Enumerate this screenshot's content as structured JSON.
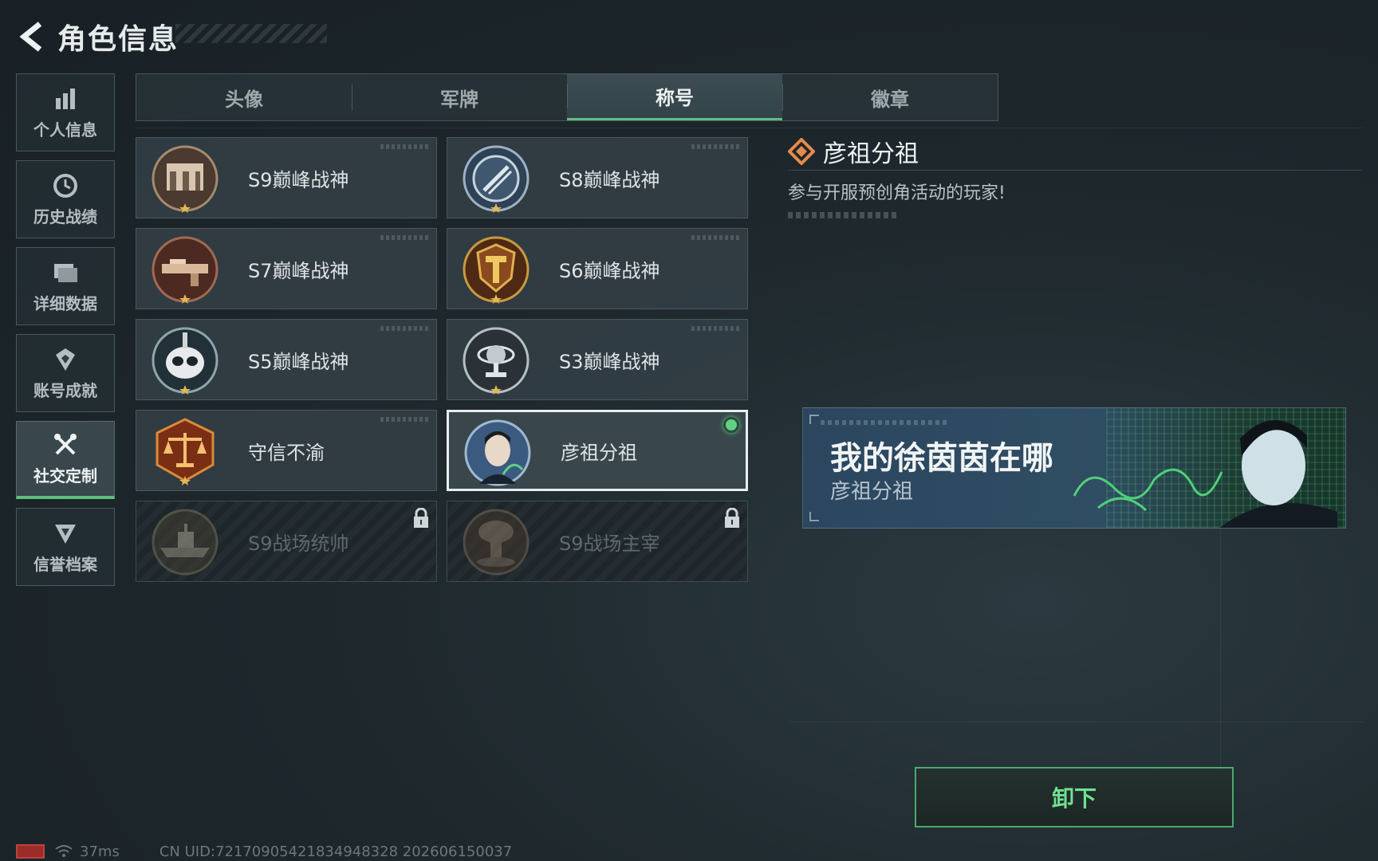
{
  "header": {
    "title": "角色信息"
  },
  "sidebar": {
    "items": [
      {
        "label": "个人信息",
        "icon": "bar-chart-icon",
        "active": false
      },
      {
        "label": "历史战绩",
        "icon": "history-clock-icon",
        "active": false
      },
      {
        "label": "详细数据",
        "icon": "folder-icon",
        "active": false
      },
      {
        "label": "账号成就",
        "icon": "achievement-icon",
        "active": false
      },
      {
        "label": "社交定制",
        "icon": "tools-icon",
        "active": true
      },
      {
        "label": "信誉档案",
        "icon": "credit-shield-icon",
        "active": false
      }
    ]
  },
  "tabs": [
    {
      "label": "头像",
      "active": false
    },
    {
      "label": "军牌",
      "active": false
    },
    {
      "label": "称号",
      "active": true
    },
    {
      "label": "徽章",
      "active": false
    }
  ],
  "titles": [
    {
      "label": "S9巅峰战神",
      "emblem": "s9-emblem-icon",
      "locked": false,
      "selected": false
    },
    {
      "label": "S8巅峰战神",
      "emblem": "s8-emblem-icon",
      "locked": false,
      "selected": false
    },
    {
      "label": "S7巅峰战神",
      "emblem": "s7-emblem-icon",
      "locked": false,
      "selected": false
    },
    {
      "label": "S6巅峰战神",
      "emblem": "s6-emblem-icon",
      "locked": false,
      "selected": false
    },
    {
      "label": "S5巅峰战神",
      "emblem": "s5-emblem-icon",
      "locked": false,
      "selected": false
    },
    {
      "label": "S3巅峰战神",
      "emblem": "s3-emblem-icon",
      "locked": false,
      "selected": false
    },
    {
      "label": "守信不渝",
      "emblem": "scales-emblem-icon",
      "locked": false,
      "selected": false
    },
    {
      "label": "彦祖分祖",
      "emblem": "portrait-emblem-icon",
      "locked": false,
      "selected": true
    },
    {
      "label": "S9战场统帅",
      "emblem": "warship-emblem-icon",
      "locked": true,
      "selected": false
    },
    {
      "label": "S9战场主宰",
      "emblem": "mushroom-cloud-emblem-icon",
      "locked": true,
      "selected": false
    }
  ],
  "detail": {
    "title": "彦祖分祖",
    "description": "参与开服预创角活动的玩家!"
  },
  "preview": {
    "main_text": "我的徐茵茵在哪",
    "sub_text": "彦祖分祖"
  },
  "actions": {
    "unequip_label": "卸下"
  },
  "status": {
    "ping": "37ms",
    "uid": "CN UID:7217090542183494832​8 202606150037"
  },
  "colors": {
    "accent": "#5fbd7e",
    "equipped": "#5fd085",
    "background": "#1e282d"
  }
}
